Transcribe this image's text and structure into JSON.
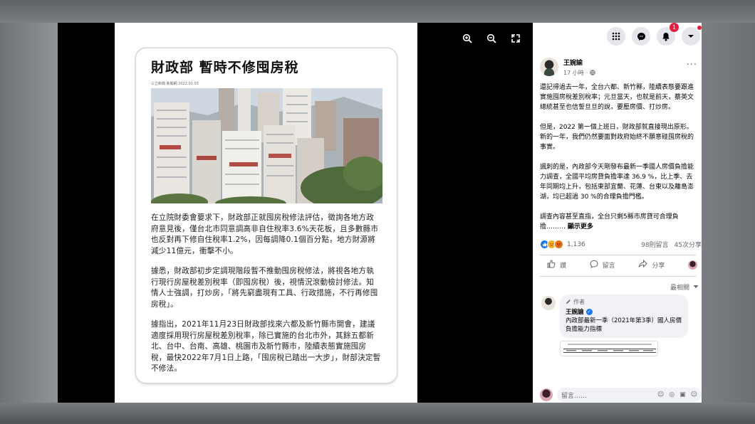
{
  "article": {
    "title": "財政部 暫時不修囤房稅",
    "source": "三立新聞 新聞網 2022.01.03",
    "paragraphs": [
      "在立院財委會要求下，財政部正就囤房稅修法評估，徵詢各地方政府意見後，僅台北市同意調高非自住稅率3.6%天花板，且多數縣市也反對再下修自住稅率1.2%，因每調降0.1個百分點，地方財源將減少11億元，衝擊不小。",
      "據悉，財政部初步定調現階段暫不推動囤房稅修法，將視各地方執行現行房屋稅差別稅率（即囤房稅）後，視情況滾動檢討修法。知情人士強調，打炒房，「將先窮盡現有工具、行政措施，不行再修囤房稅」。",
      "據指出，2021年11月23日財政部找來六都及新竹縣市開會，建議適度採用現行房屋稅差別稅率，除已實施的台北市外，其餘五都新北、台中、台南、高雄、桃園市及新竹縣市，陸續表態實施囤房稅，最快2022年7月1日上路，「囤房稅已踏出一大步」，財部決定暫不修法。"
    ]
  },
  "viewer": {
    "controls": [
      "zoom-in-icon",
      "zoom-out-icon",
      "fullscreen-icon"
    ]
  },
  "topbar": {
    "notification_count": "1",
    "icons": [
      "menu-grid-icon",
      "messenger-icon",
      "bell-icon",
      "caret-down-icon"
    ]
  },
  "post": {
    "author": "王婉諭",
    "time": "17 小時",
    "privacy_sep": "·",
    "more": "···",
    "paragraphs": [
      "還記得過去一年，全台六都、新竹縣，陸續表態要跟進實施囤房稅差別稅率；元旦當天，也就是前天，蔡英文總統甚至也信誓旦旦的說，要壓房價、打炒房。",
      "但是，2022 第一個上班日，財政部就直接現出原形。",
      "新的一年，我們仍然要面對政府始終不願意碰囤房稅的事實。",
      "諷刺的是，內政部今天剛發布最新一季國人房價負擔能力調查，全國平均房貸負擔率達 36.9 %，比上季、去年同期均上升，包括東部宜蘭、花蓮、台東以及離島澎湖，均已超過 30 %的合理負擔門檻。",
      "調查內容甚至直指，全台只剩5縣市房貸可合理負擔………"
    ],
    "see_more": "顯示更多",
    "reaction_count": "1,136",
    "comments_count": "98則留言",
    "shares_count": "45次分享",
    "actions": {
      "like": "讚",
      "comment": "留言",
      "share": "分享"
    },
    "sort_label": "最相關"
  },
  "comment": {
    "badge": "作者",
    "name": "王婉諭",
    "text": "內政部最新一季（2021年第3季）國人房價負擔能力指標"
  },
  "comment_input": {
    "placeholder": "留言……"
  },
  "colors": {
    "facebook_blue": "#1877f2",
    "badge_red": "#e41e3f",
    "text_secondary": "#65676b"
  }
}
